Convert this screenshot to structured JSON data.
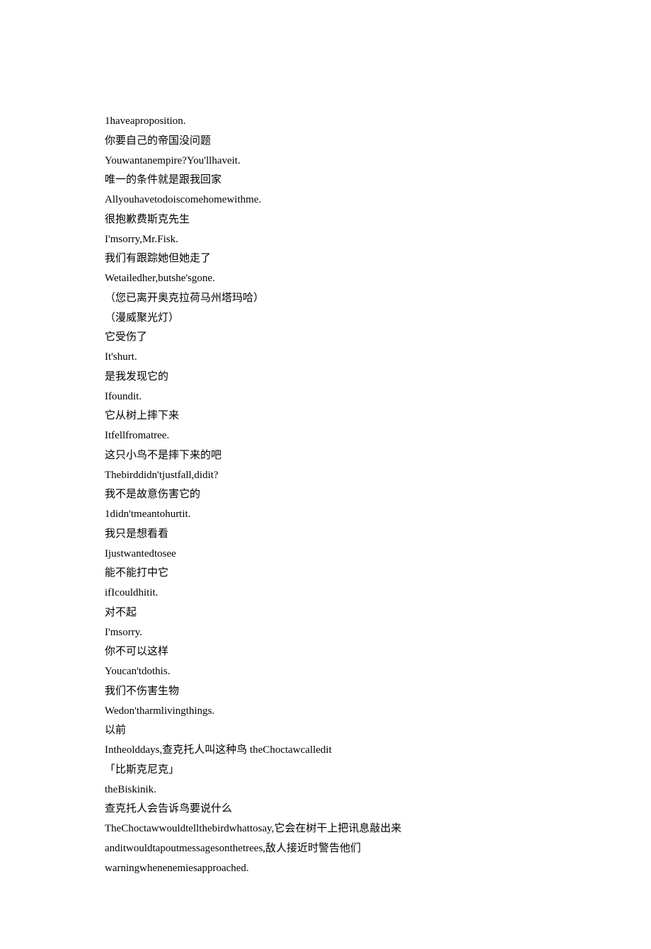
{
  "lines": [
    "1haveaproposition.",
    "你要自己的帝国没问题",
    "Youwantanempire?You'llhaveit.",
    "唯一的条件就是跟我回家",
    "Allyouhavetodoiscomehomewithme.",
    "很抱歉费斯克先生",
    "I'msorry,Mr.Fisk.",
    "我们有跟踪她但她走了",
    "Wetailedher,butshe'sgone.",
    "（您已离开奥克拉荷马州塔玛哈）",
    "（漫威聚光灯）",
    "它受伤了",
    "It'shurt.",
    "是我发现它的",
    "Ifoundit.",
    "它从树上摔下来",
    "Itfellfromatree.",
    "这只小鸟不是摔下来的吧",
    "Thebirddidn'tjustfall,didit?",
    "我不是故意伤害它的",
    "1didn'tmeantohurtit.",
    "我只是想看看",
    "Ijustwantedtosee",
    "能不能打中它",
    "ifIcouldhitit.",
    "对不起",
    "I'msorry.",
    "你不可以这样",
    "Youcan'tdothis.",
    "我们不伤害生物",
    "Wedon'tharmlivingthings.",
    "以前",
    "Intheolddays,查克托人叫这种鸟 theChoctawcalledit",
    "「比斯克尼克」",
    "theBiskinik.",
    "查克托人会告诉鸟要说什么",
    "TheChoctawwouldtellthebirdwhattosay,它会在树干上把讯息敲出来",
    "anditwouldtapoutmessagesonthetrees,敌人接近时警告他们",
    "warningwhenenemiesapproached."
  ]
}
